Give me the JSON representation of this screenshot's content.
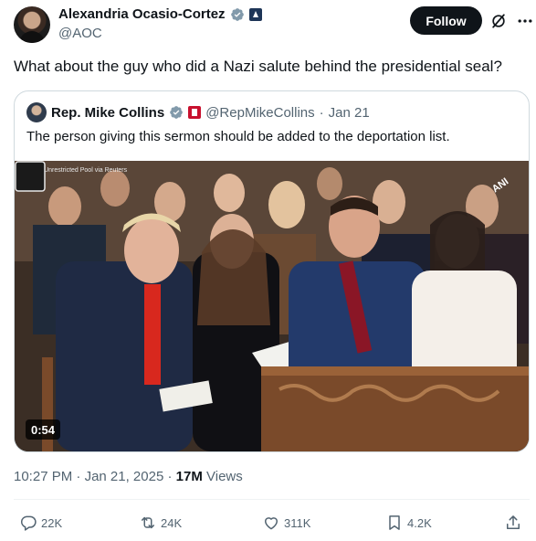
{
  "author": {
    "name": "Alexandria Ocasio-Cortez",
    "handle": "@AOC"
  },
  "follow_label": "Follow",
  "tweet_text": "What about the guy who did a Nazi salute behind the presidential seal?",
  "quote": {
    "name": "Rep. Mike Collins",
    "handle": "@RepMikeCollins",
    "separator": "·",
    "date": "Jan 21",
    "text": "The person giving this sermon should be added to the deportation list.",
    "video": {
      "source_label": "Source: Unrestricted Pool via Reuters",
      "logo_text": "ANI",
      "duration": "0:54"
    }
  },
  "meta": {
    "time": "10:27 PM",
    "date": "Jan 21, 2025",
    "separator": "·",
    "views_count": "17M",
    "views_label": "Views"
  },
  "actions": {
    "replies": "22K",
    "reposts": "24K",
    "likes": "311K",
    "bookmarks": "4.2K"
  },
  "colors": {
    "accent_verified": "#1d9bf0",
    "text_primary": "#0f1419",
    "text_secondary": "#536471",
    "border": "#cfd9de"
  },
  "icons": [
    "verified-badge-icon",
    "government-badge-icon",
    "grok-icon",
    "more-icon",
    "reply-icon",
    "repost-icon",
    "like-icon",
    "bookmark-icon",
    "share-icon"
  ]
}
